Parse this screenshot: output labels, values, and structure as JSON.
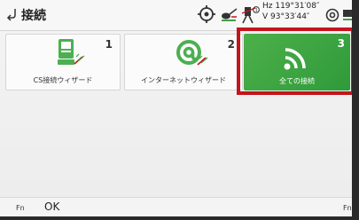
{
  "header": {
    "title": "接続",
    "hz": "Hz 119°31′08″",
    "v": "V  93°33′44″"
  },
  "tiles": [
    {
      "number": "1",
      "label": "CS接続ウィザード",
      "icon": "controller-connect-icon"
    },
    {
      "number": "2",
      "label": "インターネットウィザード",
      "icon": "at-sign-icon"
    },
    {
      "number": "3",
      "label": "全ての接続",
      "icon": "wifi-signal-icon",
      "selected": true
    }
  ],
  "footer": {
    "fn_left": "Fn",
    "ok_label": "OK",
    "fn_right": "Fn"
  },
  "colors": {
    "selected_tile": "#3aa643",
    "highlight_border": "#c5141c",
    "icon_green": "#43a047"
  }
}
